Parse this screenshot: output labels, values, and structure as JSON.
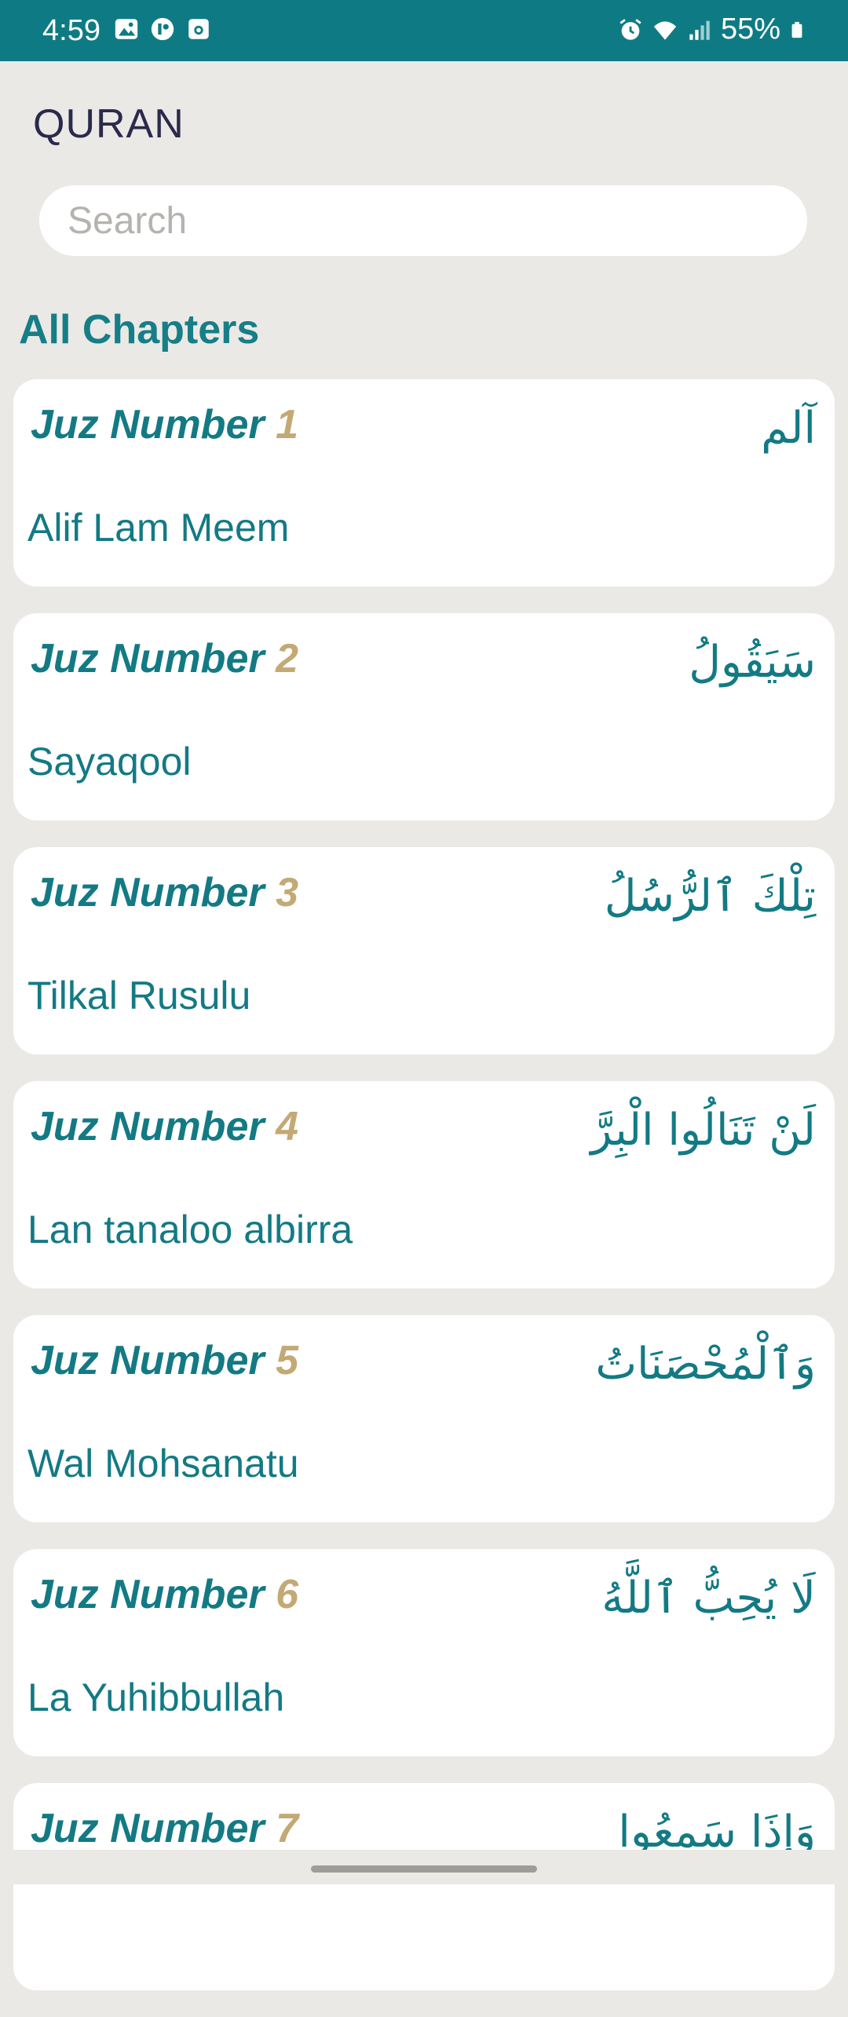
{
  "status_bar": {
    "time": "4:59",
    "battery": "55%",
    "left_icons": [
      "image-icon",
      "photo-app-icon",
      "screenshot-icon"
    ],
    "right_icons": [
      "alarm-icon",
      "wifi-icon",
      "signal-icon",
      "battery-icon"
    ]
  },
  "header": {
    "title": "QURAN"
  },
  "search": {
    "placeholder": "Search",
    "value": ""
  },
  "section": {
    "title": "All Chapters"
  },
  "juz_list": {
    "label": "Juz Number",
    "items": [
      {
        "number": "1",
        "name": "Alif Lam Meem",
        "arabic": "آلم"
      },
      {
        "number": "2",
        "name": "Sayaqool",
        "arabic": "سَيَقُولُ"
      },
      {
        "number": "3",
        "name": "Tilkal Rusulu",
        "arabic": "تِلْكَ ٱلرُّسُلُ"
      },
      {
        "number": "4",
        "name": "Lan tanaloo albirra",
        "arabic": "لَنْ تَنَالُوا الْبِرَّ"
      },
      {
        "number": "5",
        "name": "Wal Mohsanatu",
        "arabic": "وَٱلْمُحْصَنَاتُ"
      },
      {
        "number": "6",
        "name": "La Yuhibbullah",
        "arabic": "لَا يُحِبُّ ٱللَّهُ"
      },
      {
        "number": "7",
        "name": "",
        "arabic": "وَإِذَا سَمِعُوا"
      }
    ]
  },
  "colors": {
    "primary": "#0e7b84",
    "accent": "#c3a974",
    "background": "#ebe9e6"
  }
}
